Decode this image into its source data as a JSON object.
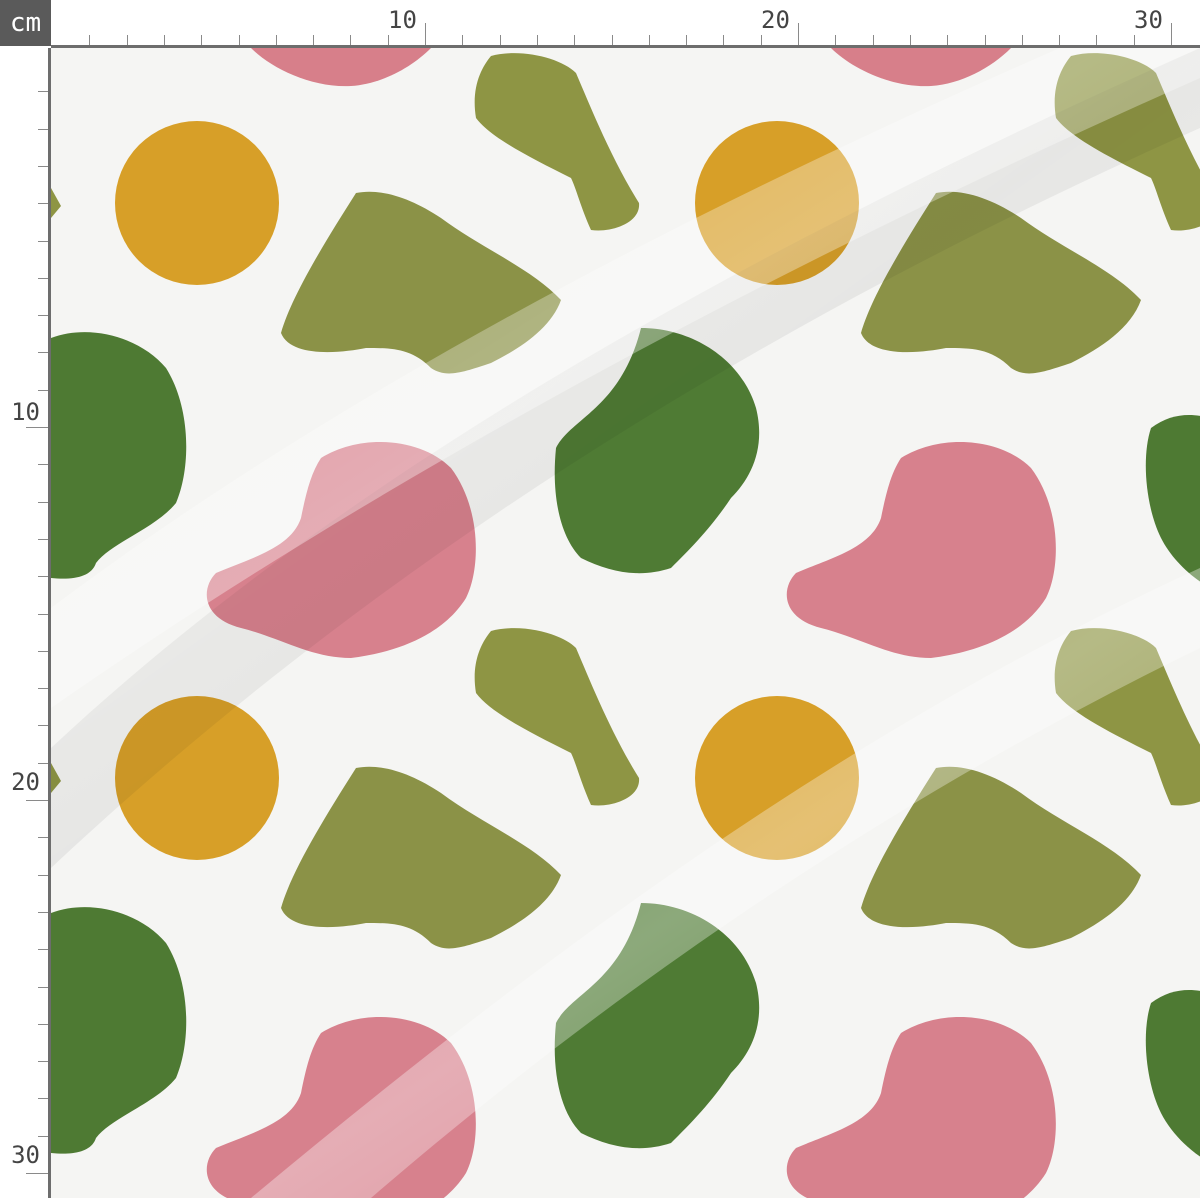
{
  "ruler": {
    "unit": "cm",
    "top_labels": [
      "10",
      "20",
      "30"
    ],
    "left_labels": [
      "10",
      "20",
      "30"
    ]
  },
  "fabric": {
    "background": "#f5f5f3",
    "colors": {
      "pink": "#d77f8a",
      "olive": "#8c9448",
      "dark_green": "#4f7a34",
      "mustard": "#d7a22a"
    }
  }
}
